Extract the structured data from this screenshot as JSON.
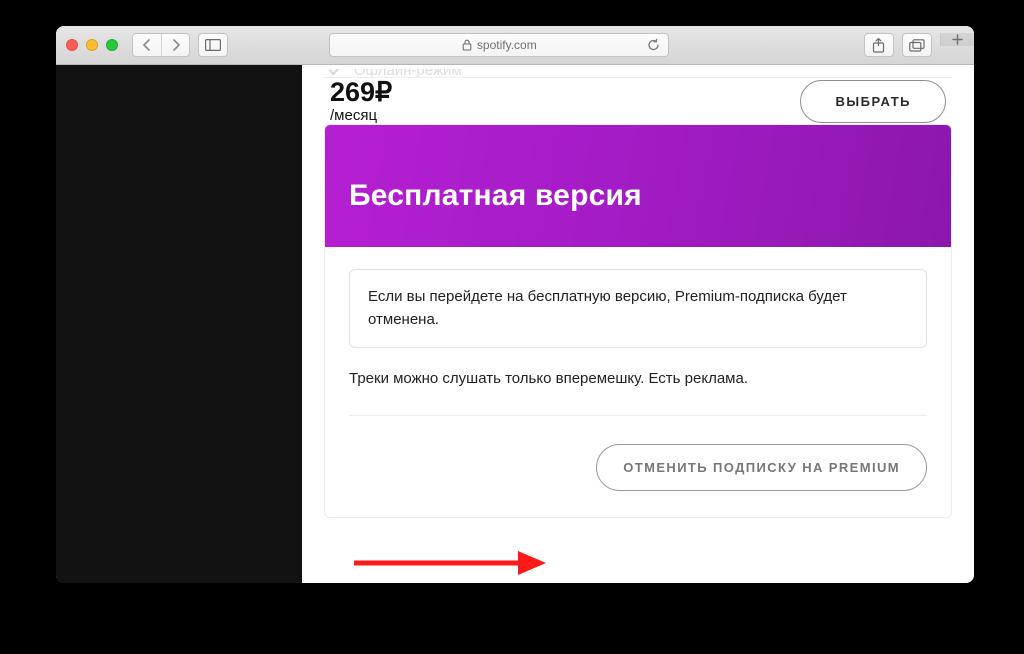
{
  "browser": {
    "url_host": "spotify.com"
  },
  "upper_plan": {
    "feature_last": "Офлайн-режим",
    "price": "269₽",
    "period": "/месяц",
    "choose_label": "ВЫБРАТЬ"
  },
  "free_plan": {
    "title": "Бесплатная версия",
    "notice": "Если вы перейдете на бесплатную версию, Premium-подписка будет отменена.",
    "description": "Треки можно слушать только вперемешку. Есть реклама.",
    "cancel_label": "ОТМЕНИТЬ ПОДПИСКУ НА PREMIUM"
  }
}
